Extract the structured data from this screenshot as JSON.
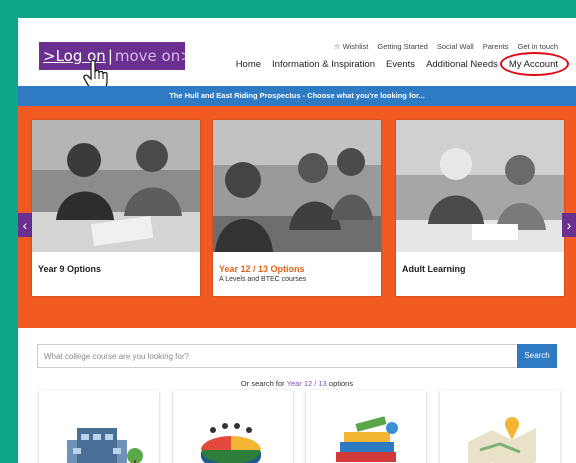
{
  "logo": {
    "part1": ">Log on",
    "sep": "|",
    "part2": "move on>"
  },
  "toplinks": {
    "wishlist": "Wishlist",
    "getting_started": "Getting Started",
    "social_wall": "Social Wall",
    "parents": "Parents",
    "get_in_touch": "Get in touch"
  },
  "nav": {
    "home": "Home",
    "info": "Information & Inspiration",
    "events": "Events",
    "additional_needs": "Additional Needs",
    "my_account": "My Account"
  },
  "banner": "The Hull and East Riding Prospectus - Choose what you're looking for...",
  "cards": [
    {
      "title": "Year 9 Options",
      "sub": ""
    },
    {
      "title": "Year 12 / 13 Options",
      "sub": "A Levels and BTEC courses"
    },
    {
      "title": "Adult Learning",
      "sub": ""
    }
  ],
  "search": {
    "placeholder": "What college course are you looking for?",
    "button": "Search"
  },
  "or_search": {
    "prefix": "Or search for ",
    "link": "Year 12 / 13",
    "suffix": " options"
  },
  "colors": {
    "accent_purple": "#6a2f8f",
    "orange": "#f15a22",
    "blue": "#2e7bc4",
    "teal_frame": "#0fa689",
    "highlight_red": "#e30613"
  }
}
